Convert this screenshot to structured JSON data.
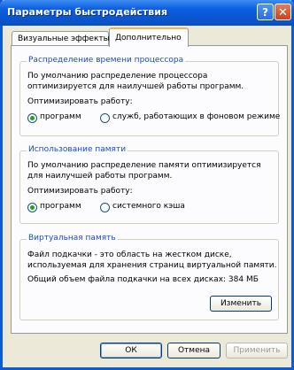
{
  "window": {
    "title": "Параметры быстродействия"
  },
  "tabs": [
    "Визуальные эффекты",
    "Дополнительно"
  ],
  "cpu_group": {
    "legend": "Распределение времени процессора",
    "desc1": "По умолчанию распределение процессора",
    "desc2": "оптимизируется для наилучшей работы программ.",
    "optimize_label": "Оптимизировать работу:",
    "radio1": "программ",
    "radio2": "служб, работающих в фоновом режиме"
  },
  "memory_group": {
    "legend": "Использование памяти",
    "desc1": "По умолчанию распределение памяти оптимизируется",
    "desc2": "для наилучшей работы программ.",
    "optimize_label": "Оптимизировать работу:",
    "radio1": "программ",
    "radio2": "системного кэша"
  },
  "vm_group": {
    "legend": "Виртуальная память",
    "desc1": "Файл подкачки - это область на жестком диске,",
    "desc2": "используемая для хранения страниц виртуальной памяти.",
    "total": "Общий объем файла подкачки на всех дисках:  384 МБ",
    "change_button": "Изменить"
  },
  "footer": {
    "ok": "ОК",
    "cancel": "Отмена",
    "apply": "Применить"
  }
}
